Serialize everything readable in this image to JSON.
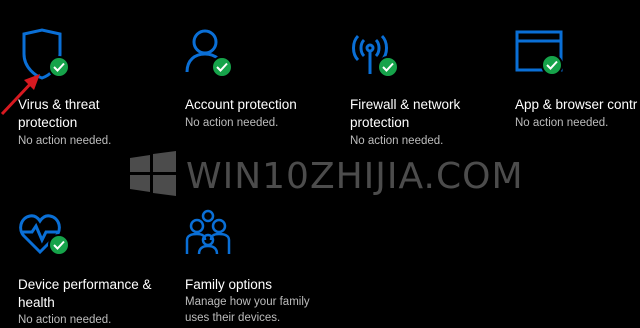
{
  "colors": {
    "accent_blue": "#0a6fd6",
    "check_green": "#16a34a",
    "status_gray": "#bdbdbd",
    "arrow_red": "#d71920"
  },
  "tiles": [
    {
      "title_line1": "Virus & threat",
      "title_line2": "protection",
      "status": "No action needed.",
      "icon": "shield-icon"
    },
    {
      "title_line1": "Account protection",
      "status": "No action needed.",
      "icon": "person-icon"
    },
    {
      "title_line1": "Firewall & network",
      "title_line2": "protection",
      "status": "No action needed.",
      "icon": "wireless-antenna-icon"
    },
    {
      "title_line1": "App & browser contr",
      "status": "No action needed.",
      "icon": "browser-window-icon"
    },
    {
      "title_line1": "Device performance &",
      "title_line2": "health",
      "status": "No action needed.",
      "icon": "heart-pulse-icon"
    },
    {
      "title_line1": "Family options",
      "status_line1": "Manage how your family",
      "status_line2": "uses their devices.",
      "icon": "family-icon"
    }
  ],
  "watermark": {
    "text": "WIN10ZHIJIA.COM"
  }
}
